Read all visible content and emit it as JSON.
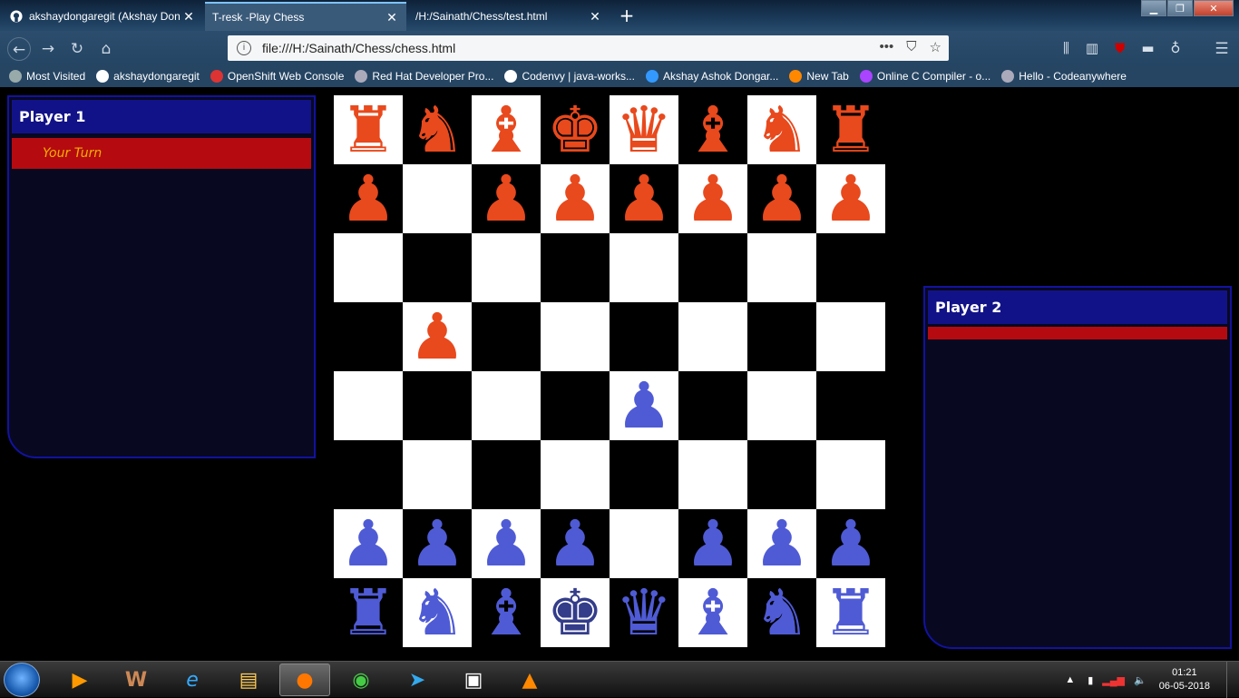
{
  "tabs": [
    {
      "title": "akshaydongaregit (Akshay Don",
      "active": false
    },
    {
      "title": "T-resk -Play Chess",
      "active": true
    },
    {
      "title": "/H:/Sainath/Chess/test.html",
      "active": false
    }
  ],
  "address": {
    "url": "file:///H:/Sainath/Chess/chess.html"
  },
  "bookmarks": [
    {
      "label": "Most Visited",
      "icon": "gear-icon",
      "color": "#9aa"
    },
    {
      "label": "akshaydongaregit",
      "icon": "github-icon",
      "color": "#fff"
    },
    {
      "label": "OpenShift Web Console",
      "icon": "openshift-icon",
      "color": "#d33"
    },
    {
      "label": "Red Hat Developer Pro...",
      "icon": "globe-icon",
      "color": "#aab"
    },
    {
      "label": "Codenvy | java-works...",
      "icon": "cloud-icon",
      "color": "#fff"
    },
    {
      "label": "Akshay Ashok Dongar...",
      "icon": "azure-icon",
      "color": "#39f"
    },
    {
      "label": "New Tab",
      "icon": "firefox-icon",
      "color": "#f80"
    },
    {
      "label": "Online C Compiler - o...",
      "icon": "bolt-icon",
      "color": "#a4f"
    },
    {
      "label": "Hello - Codeanywhere",
      "icon": "globe-icon",
      "color": "#aab"
    }
  ],
  "players": {
    "p1": {
      "name": "Player 1",
      "status": "Your Turn"
    },
    "p2": {
      "name": "Player 2",
      "status": ""
    }
  },
  "colors": {
    "top_side": "#e8491d",
    "bottom_side": "#4f5bd5",
    "bottom_king": "#343d8a",
    "panel_header": "#121288",
    "panel_status": "#b50b10"
  },
  "board": {
    "rows": [
      [
        {
          "p": "rook",
          "s": "top"
        },
        {
          "p": "knight",
          "s": "top"
        },
        {
          "p": "bishop",
          "s": "top"
        },
        {
          "p": "king",
          "s": "top"
        },
        {
          "p": "queen",
          "s": "top"
        },
        {
          "p": "bishop",
          "s": "top"
        },
        {
          "p": "knight",
          "s": "top"
        },
        {
          "p": "rook",
          "s": "top"
        }
      ],
      [
        {
          "p": "pawn",
          "s": "top"
        },
        null,
        {
          "p": "pawn",
          "s": "top"
        },
        {
          "p": "pawn",
          "s": "top"
        },
        {
          "p": "pawn",
          "s": "top"
        },
        {
          "p": "pawn",
          "s": "top"
        },
        {
          "p": "pawn",
          "s": "top"
        },
        {
          "p": "pawn",
          "s": "top"
        }
      ],
      [
        null,
        null,
        null,
        null,
        null,
        null,
        null,
        null
      ],
      [
        null,
        {
          "p": "pawn",
          "s": "top"
        },
        null,
        null,
        null,
        null,
        null,
        null
      ],
      [
        null,
        null,
        null,
        null,
        {
          "p": "pawn",
          "s": "bottom"
        },
        null,
        null,
        null
      ],
      [
        null,
        null,
        null,
        null,
        null,
        null,
        null,
        null
      ],
      [
        {
          "p": "pawn",
          "s": "bottom"
        },
        {
          "p": "pawn",
          "s": "bottom"
        },
        {
          "p": "pawn",
          "s": "bottom"
        },
        {
          "p": "pawn",
          "s": "bottom"
        },
        null,
        {
          "p": "pawn",
          "s": "bottom"
        },
        {
          "p": "pawn",
          "s": "bottom"
        },
        {
          "p": "pawn",
          "s": "bottom"
        }
      ],
      [
        {
          "p": "rook",
          "s": "bottom"
        },
        {
          "p": "knight",
          "s": "bottom"
        },
        {
          "p": "bishop",
          "s": "bottom"
        },
        {
          "p": "king",
          "s": "bottom"
        },
        {
          "p": "queen",
          "s": "bottom"
        },
        {
          "p": "bishop",
          "s": "bottom"
        },
        {
          "p": "knight",
          "s": "bottom"
        },
        {
          "p": "rook",
          "s": "bottom"
        }
      ]
    ]
  },
  "taskbar": {
    "apps": [
      "media-player-icon",
      "word-icon",
      "internet-explorer-icon",
      "file-explorer-icon",
      "firefox-icon",
      "chrome-icon",
      "telegram-icon",
      "app-icon",
      "vlc-icon"
    ],
    "time": "01:21",
    "date": "06-05-2018"
  }
}
